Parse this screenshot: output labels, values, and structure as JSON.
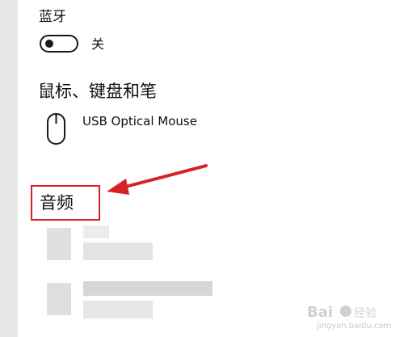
{
  "bluetooth": {
    "title": "蓝牙",
    "toggle_state": "关"
  },
  "mouse_section": {
    "title": "鼠标、键盘和笔",
    "device_icon": "mouse-icon",
    "device_name": "USB Optical Mouse"
  },
  "audio_section": {
    "title": "音频"
  },
  "annotation": {
    "highlight_color": "#d72027",
    "arrow_color": "#d72027"
  },
  "watermark": {
    "site": "jingyan.baidu.com"
  }
}
